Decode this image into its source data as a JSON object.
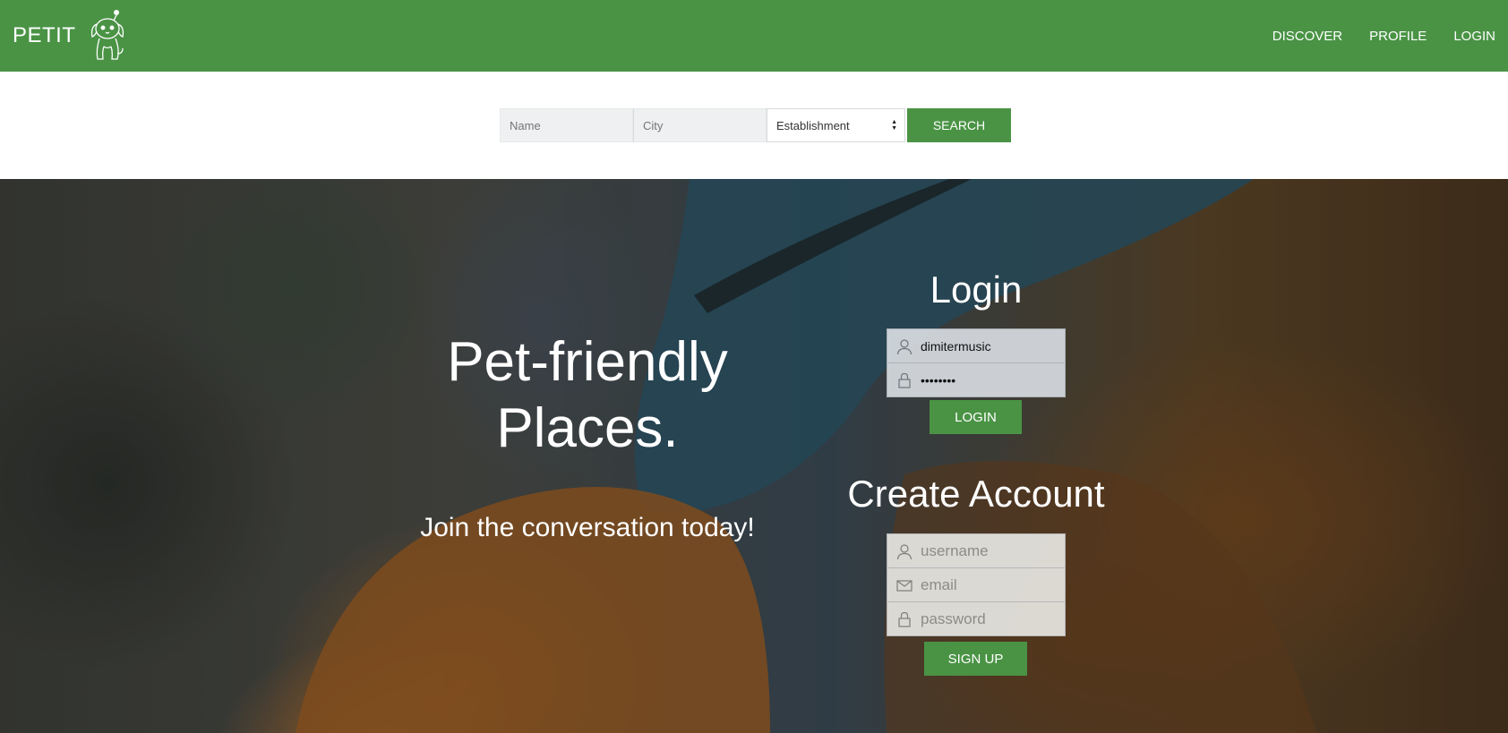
{
  "header": {
    "brand": "PETIT",
    "nav": [
      "DISCOVER",
      "PROFILE",
      "LOGIN"
    ]
  },
  "search": {
    "name_placeholder": "Name",
    "city_placeholder": "City",
    "establishment_selected": "Establishment",
    "button_label": "SEARCH"
  },
  "hero": {
    "tagline_line1": "Pet-friendly",
    "tagline_line2": "Places.",
    "subtagline": "Join the conversation today!"
  },
  "login": {
    "title": "Login",
    "username_value": "dimitermusic",
    "password_value": "••••••••",
    "button_label": "LOGIN"
  },
  "signup": {
    "title": "Create Account",
    "username_placeholder": "username",
    "email_placeholder": "email",
    "password_placeholder": "password",
    "button_label": "SIGN UP"
  },
  "colors": {
    "accent": "#4a9345",
    "text_on_accent": "#ffffff"
  },
  "icons": {
    "logo": "dog-logo-icon",
    "user": "user-icon",
    "lock": "lock-icon",
    "email": "envelope-icon"
  }
}
